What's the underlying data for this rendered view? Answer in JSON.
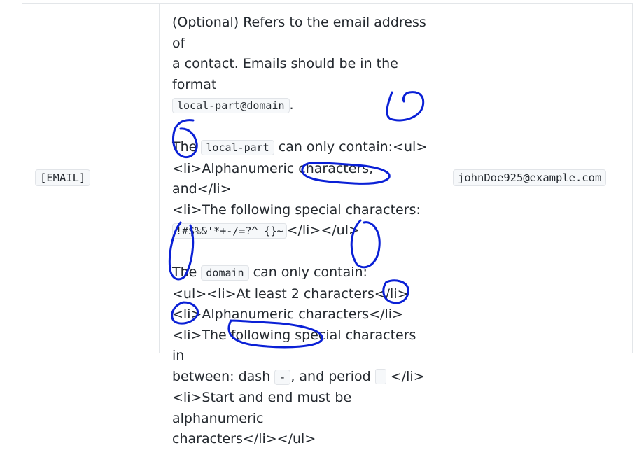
{
  "row": {
    "parameter": "[EMAIL]",
    "example": "johnDoe925@example.com",
    "description": {
      "intro_1": "(Optional) Refers to the email address of",
      "intro_2": "a contact. Emails should be in the format",
      "format_code": "local-part@domain",
      "period": ".",
      "local_prefix": "The",
      "local_code": "local-part",
      "local_suffix": "can only contain:<ul>",
      "local_li1": "<li>Alphanumeric characters, and</li>",
      "local_li2": "<li>The following special characters:",
      "local_special": "!#$%&'*+-/=?^_{}~",
      "local_close": "</li></ul>",
      "domain_prefix": "The",
      "domain_code": "domain",
      "domain_suffix": "can only contain:",
      "domain_li1": "<ul><li>At least 2 characters</li>",
      "domain_li2": "<li>Alphanumeric characters</li>",
      "domain_li3a": "<li>The following special characters in",
      "domain_li3b_1": "between: dash",
      "dash_code": "-",
      "domain_li3b_2": ", and period",
      "domain_li3b_3": "</li>",
      "domain_li4a": "<li>Start and end must be alphanumeric",
      "domain_li4b": "characters</li></ul>"
    }
  },
  "annotation": {
    "color": "#0a20d6"
  }
}
